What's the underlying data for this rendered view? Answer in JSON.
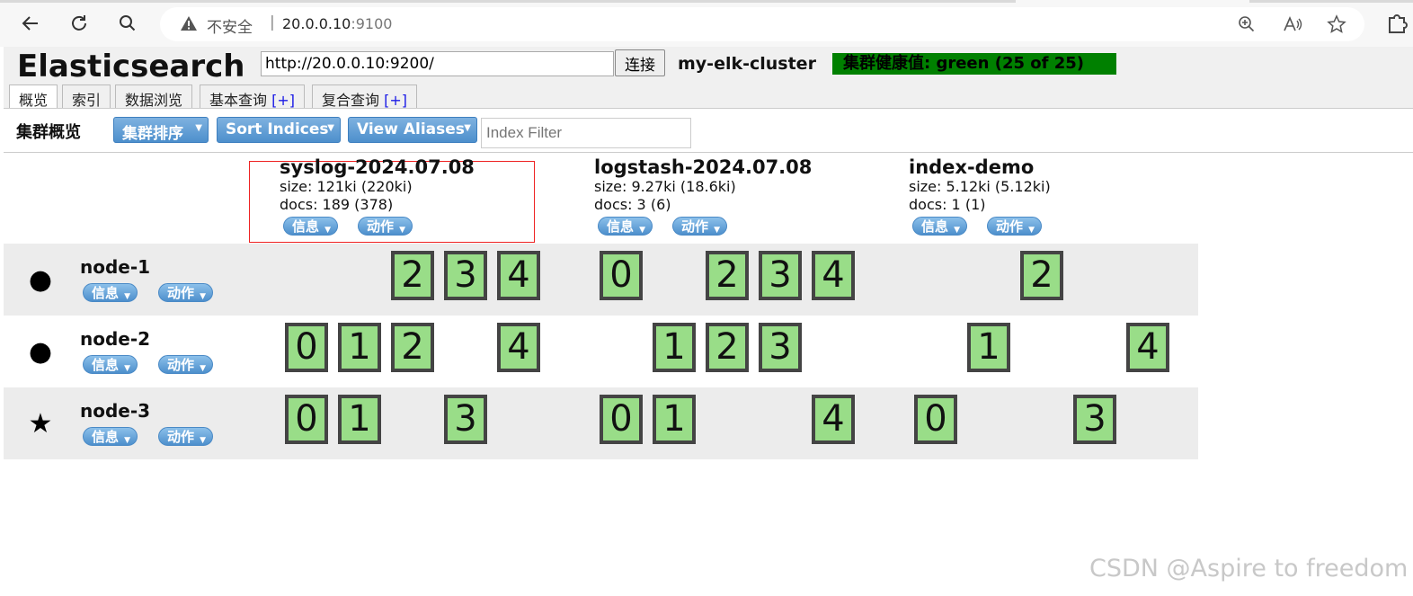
{
  "browser": {
    "insecure_label": "不安全",
    "separator": "|",
    "host": "20.0.0.10",
    "port": ":9100"
  },
  "app": {
    "brand": "Elasticsearch",
    "connect_url": "http://20.0.0.10:9200/",
    "connect_label": "连接",
    "cluster_name": "my-elk-cluster",
    "health": "集群健康值: green (25 of 25)",
    "health_color": "#008000"
  },
  "tabs": [
    {
      "label": "概览"
    },
    {
      "label": "索引"
    },
    {
      "label": "数据浏览"
    },
    {
      "label": "基本查询",
      "plus": "[+]"
    },
    {
      "label": "复合查询",
      "plus": "[+]"
    }
  ],
  "toolbar": {
    "title": "集群概览",
    "sort_cluster": "集群排序",
    "sort_indices": "Sort Indices",
    "view_aliases": "View Aliases",
    "filter_placeholder": "Index Filter"
  },
  "pill_labels": {
    "info": "信息",
    "action": "动作"
  },
  "indices": [
    {
      "name": "syslog-2024.07.08",
      "size": "size: 121ki (220ki)",
      "docs": "docs: 189 (378)"
    },
    {
      "name": "logstash-2024.07.08",
      "size": "size: 9.27ki (18.6ki)",
      "docs": "docs: 3 (6)"
    },
    {
      "name": "index-demo",
      "size": "size: 5.12ki (5.12ki)",
      "docs": "docs: 1 (1)"
    }
  ],
  "nodes": [
    {
      "name": "node-1",
      "status_icon": "circle-icon",
      "status_glyph": "●",
      "shards": [
        [
          2,
          3,
          4
        ],
        [
          0,
          2,
          3,
          4
        ],
        [
          2
        ]
      ]
    },
    {
      "name": "node-2",
      "status_icon": "circle-icon",
      "status_glyph": "●",
      "shards": [
        [
          0,
          1,
          2,
          4
        ],
        [
          1,
          2,
          3
        ],
        [
          1,
          4
        ]
      ]
    },
    {
      "name": "node-3",
      "status_icon": "star-icon",
      "status_glyph": "★",
      "shards": [
        [
          0,
          1,
          3
        ],
        [
          0,
          1,
          4
        ],
        [
          0,
          3
        ]
      ]
    }
  ],
  "watermark": "CSDN @Aspire to freedom"
}
